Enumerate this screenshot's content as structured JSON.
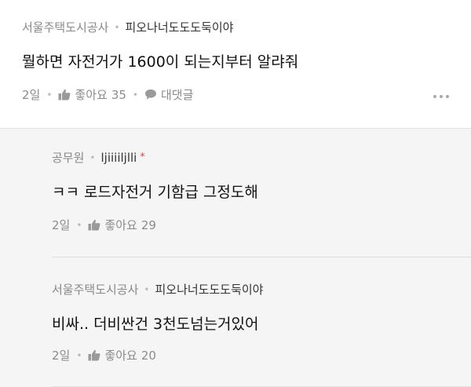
{
  "comment": {
    "author": "서울주택도시공사",
    "nickname": "피오나너도도도둑이야",
    "text": "뭘하면 자전거가 1600이 되는지부터 알랴줘",
    "time": "2일",
    "like_label": "좋아요",
    "like_count": "35",
    "reply_label": "대댓글"
  },
  "replies": [
    {
      "author": "공무원",
      "nickname": "ljiiiiljlli",
      "badge": "*",
      "text": "ㅋㅋ 로드자전거 기함급 그정도해",
      "time": "2일",
      "like_label": "좋아요",
      "like_count": "29"
    },
    {
      "author": "서울주택도시공사",
      "nickname": "피오나너도도도둑이야",
      "text": "비싸.. 더비싼건 3천도넘는거있어",
      "time": "2일",
      "like_label": "좋아요",
      "like_count": "20"
    }
  ],
  "icons": {
    "like": "thumbs-up-icon",
    "reply": "speech-bubble-icon",
    "more": "more-dots-icon"
  },
  "colors": {
    "badge": "#e4473a",
    "reply_bg": "#f5f5f5"
  }
}
